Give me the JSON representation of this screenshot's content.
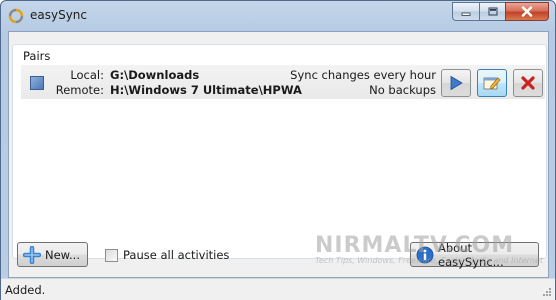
{
  "window": {
    "title": "easySync",
    "controls": {
      "minimize": "minimize",
      "maximize": "maximize",
      "close": "close"
    }
  },
  "pairs_group": {
    "label": "Pairs",
    "pairs": [
      {
        "local_label": "Local:",
        "local_path": "G:\\Downloads",
        "remote_label": "Remote:",
        "remote_path": "H:\\Windows 7 Ultimate\\HPWA",
        "schedule": "Sync changes every hour",
        "backups": "No backups",
        "actions": [
          {
            "name": "play-icon",
            "label": "Sync now"
          },
          {
            "name": "edit-icon",
            "label": "Edit"
          },
          {
            "name": "delete-icon",
            "label": "Delete"
          }
        ]
      }
    ]
  },
  "bottom": {
    "new_button": "New...",
    "pause_checkbox_label": "Pause all activities",
    "pause_checked": false,
    "about_button": "About easySync..."
  },
  "status": {
    "text": "Added."
  },
  "watermark": {
    "main": "NIRMALTV.COM",
    "sub": "Tech Tips, Windows, Freeware, Social Media and Internet"
  },
  "colors": {
    "title_bar": "#b6cbe3",
    "close_button": "#c2432a",
    "play_icon": "#3d7ac9",
    "delete_icon": "#c8231f",
    "new_icon": "#3a82d2",
    "info_icon": "#2b6fc6"
  }
}
